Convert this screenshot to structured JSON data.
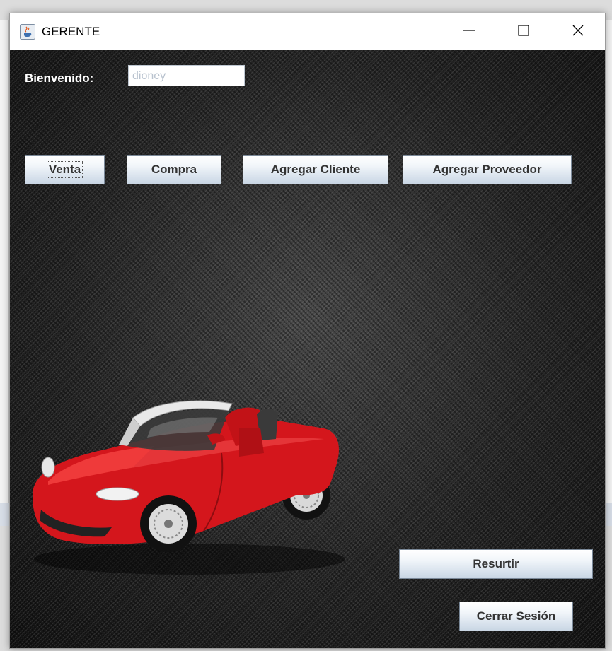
{
  "window": {
    "title": "GERENTE"
  },
  "header": {
    "welcome_label": "Bienvenido:",
    "user_value": "dioney"
  },
  "menu_buttons": [
    {
      "label": "Venta"
    },
    {
      "label": "Compra"
    },
    {
      "label": "Agregar Cliente"
    },
    {
      "label": "Agregar Proveedor"
    }
  ],
  "actions": {
    "resurtir_label": "Resurtir",
    "logout_label": "Cerrar Sesión"
  },
  "icons": {
    "app": "java-cup-icon",
    "minimize": "minimize-icon",
    "maximize": "maximize-icon",
    "close": "close-icon",
    "image": "red-convertible-car"
  },
  "colors": {
    "background": "#1c1c1c",
    "button_top": "#ffffff",
    "button_bottom": "#c9d6e4",
    "car": "#d4161c"
  }
}
